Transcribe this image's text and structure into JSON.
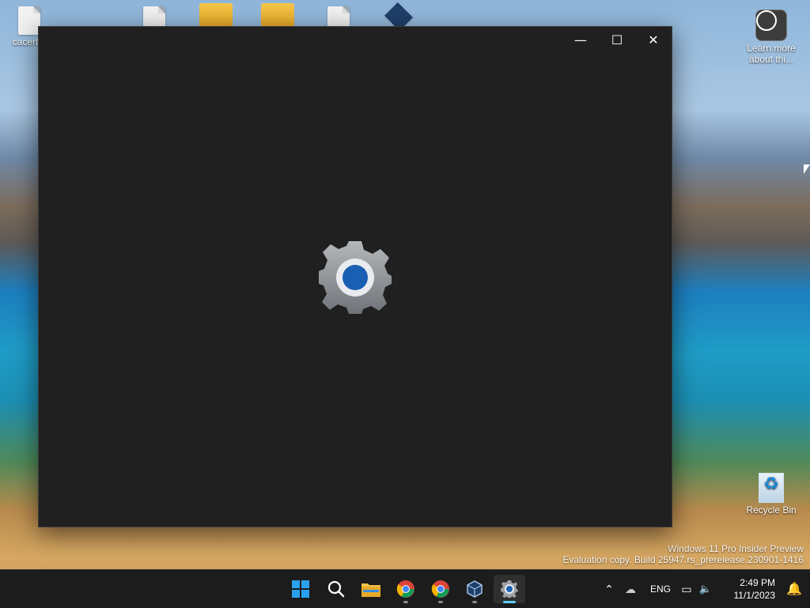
{
  "desktop": {
    "icons": [
      {
        "label": "cacert.p"
      },
      {
        "label": ""
      },
      {
        "label": ""
      },
      {
        "label": ""
      },
      {
        "label": ""
      },
      {
        "label": ""
      }
    ],
    "learn_more": "Learn more about thi...",
    "recycle_bin": "Recycle Bin",
    "watermark_line1": "Windows 11 Pro Insider Preview",
    "watermark_line2": "Evaluation copy. Build 25947.rs_prerelease.230901-1416"
  },
  "window": {
    "minimize": "—",
    "maximize": "☐",
    "close": "✕",
    "splash_icon": "settings-gear-icon"
  },
  "taskbar": {
    "apps": [
      {
        "name": "start-button",
        "icon": "windows-logo"
      },
      {
        "name": "search-button",
        "icon": "search"
      },
      {
        "name": "file-explorer",
        "icon": "folder"
      },
      {
        "name": "chrome-1",
        "icon": "chrome"
      },
      {
        "name": "chrome-2",
        "icon": "chrome"
      },
      {
        "name": "virtualbox",
        "icon": "virtualbox"
      },
      {
        "name": "settings",
        "icon": "settings-gear"
      }
    ],
    "language": "ENG",
    "time": "2:49 PM",
    "date": "11/1/2023"
  },
  "colors": {
    "taskbar": "#1c1c1c",
    "window": "#202020",
    "accent": "#60cdff",
    "gear_blue": "#1a5fb4"
  }
}
